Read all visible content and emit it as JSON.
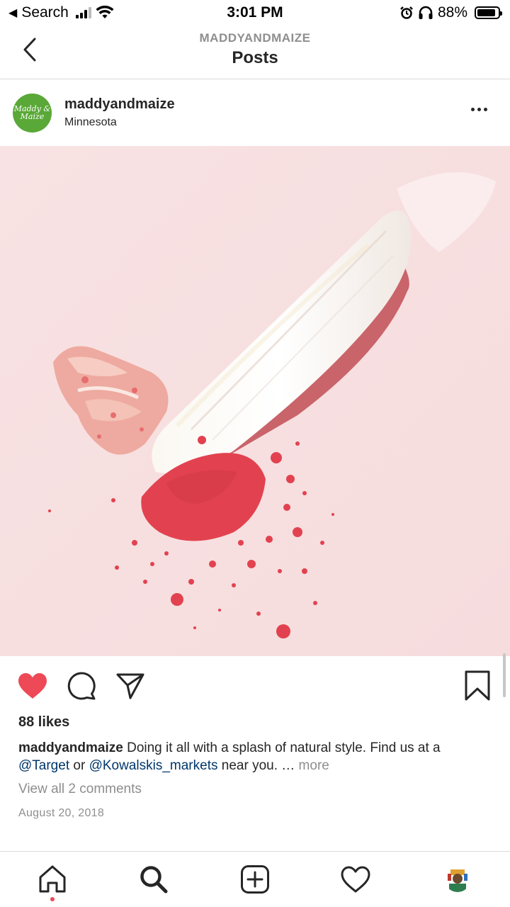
{
  "status_bar": {
    "back_app": "Search",
    "time": "3:01 PM",
    "battery_percent": "88%",
    "battery_level": 0.88
  },
  "header": {
    "subtitle": "MADDYANDMAIZE",
    "title": "Posts"
  },
  "post": {
    "avatar_text": "Maddy & Maize",
    "username": "maddyandmaize",
    "location": "Minnesota",
    "likes": "88 likes",
    "caption": {
      "username": "maddyandmaize",
      "text_1": "Doing it all with a splash of natural style. Find us at a",
      "mention_1": "@Target",
      "text_2": "or",
      "mention_2": "@Kowalskis_markets",
      "text_3": "near you. …",
      "more": "more"
    },
    "view_comments": "View all 2 comments",
    "date": "August 20, 2018",
    "liked": true
  },
  "colors": {
    "like_red": "#ed4956",
    "avatar_green": "#5aa837",
    "mention_blue": "#00376b",
    "image_bg": "#f7dfe0",
    "powder_red": "#e2424f"
  },
  "icons": {
    "back": "chevron-left-icon",
    "more": "more-horizontal-icon",
    "like": "heart-filled-icon",
    "comment": "comment-bubble-icon",
    "share": "paper-plane-icon",
    "save": "bookmark-icon",
    "tabs": [
      "home-icon",
      "search-icon",
      "add-post-icon",
      "activity-heart-icon",
      "profile-avatar"
    ]
  }
}
